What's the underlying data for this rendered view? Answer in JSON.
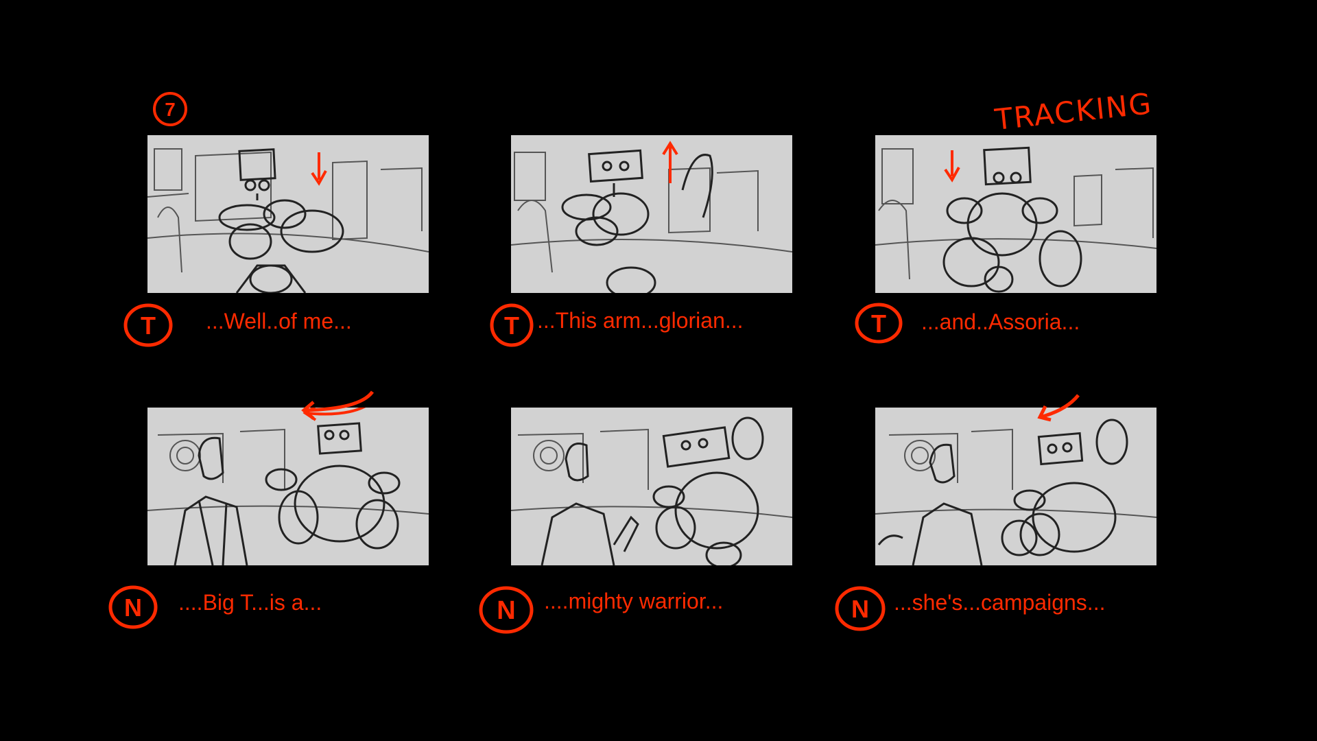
{
  "scene_number": "7",
  "camera_note": "TRACKING",
  "colors": {
    "background": "#000000",
    "annotation": "#ff2a00",
    "panel": "#d2d2d2",
    "sketch": "#222222"
  },
  "panels": [
    {
      "speaker": "T",
      "caption": "...Well..of me...",
      "arrow": "down"
    },
    {
      "speaker": "T",
      "caption": "...This arm...glorian...",
      "arrow": "up"
    },
    {
      "speaker": "T",
      "caption": "...and..Assoria...",
      "arrow": "down"
    },
    {
      "speaker": "N",
      "caption": "....Big T...is a...",
      "arrow": "curve-left"
    },
    {
      "speaker": "N",
      "caption": "....mighty warrior...",
      "arrow": "none"
    },
    {
      "speaker": "N",
      "caption": "...she's...campaigns...",
      "arrow": "curve-left"
    }
  ]
}
